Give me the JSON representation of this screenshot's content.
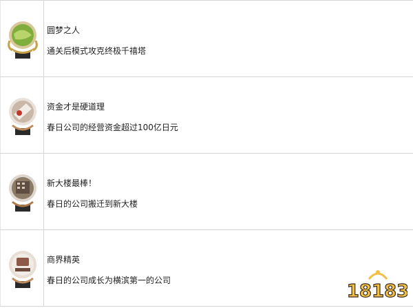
{
  "achievements": [
    {
      "title": "圆梦之人",
      "description": "通关后模式攻克终极千禧塔",
      "icon": "trophy-green-icon",
      "color": "#7fae3c"
    },
    {
      "title": "资金才是硬道理",
      "description": "春日公司的经营资金超过100亿日元",
      "icon": "trophy-money-icon",
      "color": "#c9b7a8"
    },
    {
      "title": "新大楼最棒！",
      "description": "春日的公司搬迁到新大楼",
      "icon": "trophy-building-icon",
      "color": "#8a7a66"
    },
    {
      "title": "商界精英",
      "description": "春日的公司成长为横滨第一的公司",
      "icon": "trophy-ichiban-icon",
      "color": "#8d5a4a"
    }
  ],
  "watermark": {
    "text": "18183",
    "icon": "18183-logo-icon"
  }
}
